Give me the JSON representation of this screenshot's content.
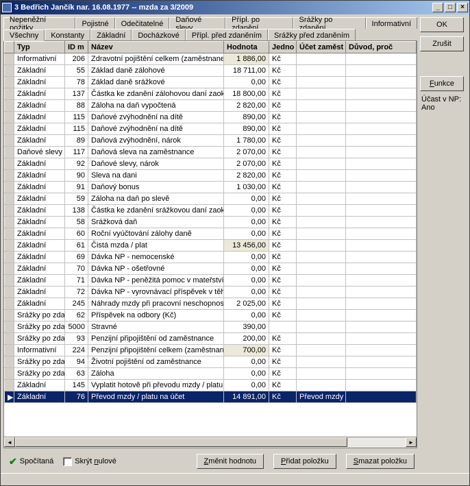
{
  "window": {
    "title": "3 Bedřich Jančík nar. 16.08.1977 -- mzda za 3/2009"
  },
  "tabs_row1": [
    "Nepeněžní požitky",
    "Pojistné",
    "Odečitatelné",
    "Daňové slevy",
    "Přípl. po zdanění",
    "Srážky po zdanění",
    "Informativní"
  ],
  "tabs_row2": [
    "Všechny",
    "Konstanty",
    "Základní",
    "Docházkové",
    "Přípl. před zdaněním",
    "Srážky před zdaněním"
  ],
  "active_tab": "Všechny",
  "columns": [
    "Typ",
    "ID m",
    "Název",
    "Hodnota",
    "Jedno",
    "Účet zaměst",
    "Důvod, proč"
  ],
  "rows": [
    {
      "typ": "Informativní",
      "id": "206",
      "nazev": "Zdravotní pojištění celkem (zaměstnanec",
      "hodnota": "1 886,00",
      "jedn": "Kč",
      "ucet": "",
      "duvod": "",
      "shade": true
    },
    {
      "typ": "Základní",
      "id": "55",
      "nazev": "Základ daně zálohové",
      "hodnota": "18 711,00",
      "jedn": "Kč",
      "ucet": "",
      "duvod": ""
    },
    {
      "typ": "Základní",
      "id": "78",
      "nazev": "Základ daně srážkové",
      "hodnota": "0,00",
      "jedn": "Kč",
      "ucet": "",
      "duvod": ""
    },
    {
      "typ": "Základní",
      "id": "137",
      "nazev": "Částka ke zdanění zálohovou daní zaok",
      "hodnota": "18 800,00",
      "jedn": "Kč",
      "ucet": "",
      "duvod": ""
    },
    {
      "typ": "Základní",
      "id": "88",
      "nazev": "Záloha na daň vypočtená",
      "hodnota": "2 820,00",
      "jedn": "Kč",
      "ucet": "",
      "duvod": ""
    },
    {
      "typ": "Základní",
      "id": "115",
      "nazev": "Daňové zvýhodnění na dítě",
      "hodnota": "890,00",
      "jedn": "Kč",
      "ucet": "",
      "duvod": ""
    },
    {
      "typ": "Základní",
      "id": "115",
      "nazev": "Daňové zvýhodnění na dítě",
      "hodnota": "890,00",
      "jedn": "Kč",
      "ucet": "",
      "duvod": ""
    },
    {
      "typ": "Základní",
      "id": "89",
      "nazev": "Daňová zvýhodnění, nárok",
      "hodnota": "1 780,00",
      "jedn": "Kč",
      "ucet": "",
      "duvod": ""
    },
    {
      "typ": "Daňové slevy",
      "id": "117",
      "nazev": "Daňová sleva na zaměstnance",
      "hodnota": "2 070,00",
      "jedn": "Kč",
      "ucet": "",
      "duvod": ""
    },
    {
      "typ": "Základní",
      "id": "92",
      "nazev": "Daňové slevy, nárok",
      "hodnota": "2 070,00",
      "jedn": "Kč",
      "ucet": "",
      "duvod": ""
    },
    {
      "typ": "Základní",
      "id": "90",
      "nazev": "Sleva na dani",
      "hodnota": "2 820,00",
      "jedn": "Kč",
      "ucet": "",
      "duvod": ""
    },
    {
      "typ": "Základní",
      "id": "91",
      "nazev": "Daňový bonus",
      "hodnota": "1 030,00",
      "jedn": "Kč",
      "ucet": "",
      "duvod": ""
    },
    {
      "typ": "Základní",
      "id": "59",
      "nazev": "Záloha na daň po slevě",
      "hodnota": "0,00",
      "jedn": "Kč",
      "ucet": "",
      "duvod": ""
    },
    {
      "typ": "Základní",
      "id": "138",
      "nazev": "Částka ke zdanění srážkovou daní zaok",
      "hodnota": "0,00",
      "jedn": "Kč",
      "ucet": "",
      "duvod": ""
    },
    {
      "typ": "Základní",
      "id": "58",
      "nazev": "Srážková daň",
      "hodnota": "0,00",
      "jedn": "Kč",
      "ucet": "",
      "duvod": ""
    },
    {
      "typ": "Základní",
      "id": "60",
      "nazev": "Roční vyúčtování zálohy daně",
      "hodnota": "0,00",
      "jedn": "Kč",
      "ucet": "",
      "duvod": ""
    },
    {
      "typ": "Základní",
      "id": "61",
      "nazev": "Čistá mzda / plat",
      "hodnota": "13 456,00",
      "jedn": "Kč",
      "ucet": "",
      "duvod": "",
      "shade": true
    },
    {
      "typ": "Základní",
      "id": "69",
      "nazev": "Dávka NP - nemocenské",
      "hodnota": "0,00",
      "jedn": "Kč",
      "ucet": "",
      "duvod": ""
    },
    {
      "typ": "Základní",
      "id": "70",
      "nazev": "Dávka NP - ošetřovné",
      "hodnota": "0,00",
      "jedn": "Kč",
      "ucet": "",
      "duvod": ""
    },
    {
      "typ": "Základní",
      "id": "71",
      "nazev": "Dávka NP - peněžitá pomoc v mateřství",
      "hodnota": "0,00",
      "jedn": "Kč",
      "ucet": "",
      "duvod": ""
    },
    {
      "typ": "Základní",
      "id": "72",
      "nazev": "Dávka NP - vyrovnávací příspěvek v těh",
      "hodnota": "0,00",
      "jedn": "Kč",
      "ucet": "",
      "duvod": ""
    },
    {
      "typ": "Základní",
      "id": "245",
      "nazev": "Náhrady mzdy při pracovní neschopnost",
      "hodnota": "2 025,00",
      "jedn": "Kč",
      "ucet": "",
      "duvod": ""
    },
    {
      "typ": "Srážky po zda",
      "id": "62",
      "nazev": "Příspěvek na odbory (Kč)",
      "hodnota": "0,00",
      "jedn": "Kč",
      "ucet": "",
      "duvod": ""
    },
    {
      "typ": "Srážky po zda",
      "id": "5000",
      "nazev": "Stravné",
      "hodnota": "390,00",
      "jedn": "",
      "ucet": "",
      "duvod": ""
    },
    {
      "typ": "Srážky po zda",
      "id": "93",
      "nazev": "Penzijní připojištění od zaměstnance",
      "hodnota": "200,00",
      "jedn": "Kč",
      "ucet": "",
      "duvod": ""
    },
    {
      "typ": "Informativní",
      "id": "224",
      "nazev": "Penzijní připojištění celkem (zaměstnane",
      "hodnota": "700,00",
      "jedn": "Kč",
      "ucet": "",
      "duvod": "",
      "shade": true
    },
    {
      "typ": "Srážky po zda",
      "id": "94",
      "nazev": "Životní pojištění od zaměstnance",
      "hodnota": "0,00",
      "jedn": "Kč",
      "ucet": "",
      "duvod": ""
    },
    {
      "typ": "Srážky po zda",
      "id": "63",
      "nazev": "Záloha",
      "hodnota": "0,00",
      "jedn": "Kč",
      "ucet": "",
      "duvod": ""
    },
    {
      "typ": "Základní",
      "id": "145",
      "nazev": "Vyplatit hotově při převodu mzdy / platu",
      "hodnota": "0,00",
      "jedn": "Kč",
      "ucet": "",
      "duvod": ""
    },
    {
      "typ": "Základní",
      "id": "76",
      "nazev": "Převod mzdy / platu na účet",
      "hodnota": "14 891,00",
      "jedn": "Kč",
      "ucet": "Převod mzdy n",
      "duvod": "",
      "selected": true
    }
  ],
  "buttons": {
    "ok": "OK",
    "cancel": "Zrušit",
    "functions": "Funkce",
    "status_text": "Spočítaná",
    "hide_zero": "Skrýt nulové",
    "change": "Změnit hodnotu",
    "add": "Přidat položku",
    "delete": "Smazat položku"
  },
  "info": {
    "ucast": "Účast v NP: Ano"
  }
}
